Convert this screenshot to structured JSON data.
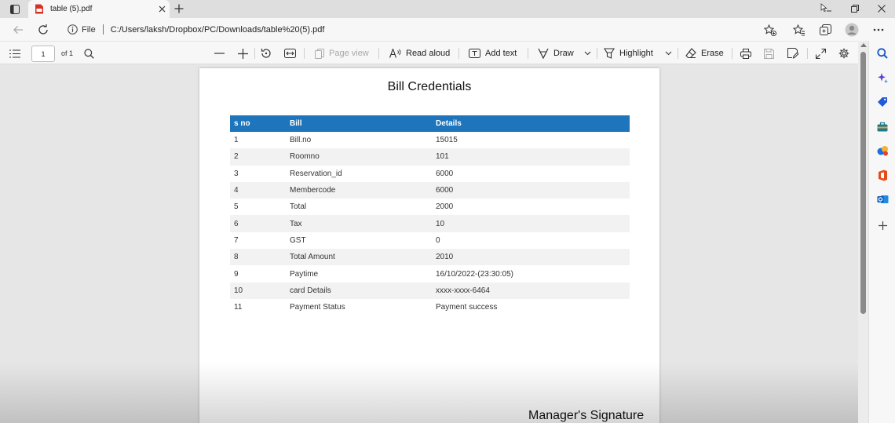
{
  "browser": {
    "tab_title": "table (5).pdf",
    "address": {
      "scheme_label": "File",
      "url": "C:/Users/laksh/Dropbox/PC/Downloads/table%20(5).pdf"
    }
  },
  "pdf_toolbar": {
    "page_number": "1",
    "page_of": "of 1",
    "page_view_label": "Page view",
    "read_aloud_label": "Read aloud",
    "add_text_label": "Add text",
    "draw_label": "Draw",
    "highlight_label": "Highlight",
    "erase_label": "Erase"
  },
  "document": {
    "title": "Bill Credentials",
    "columns": [
      "s no",
      "Bill",
      "Details"
    ],
    "rows": [
      [
        "1",
        "Bill.no",
        "15015"
      ],
      [
        "2",
        "Roomno",
        "101"
      ],
      [
        "3",
        "Reservation_id",
        "6000"
      ],
      [
        "4",
        "Membercode",
        "6000"
      ],
      [
        "5",
        "Total",
        "2000"
      ],
      [
        "6",
        "Tax",
        "10"
      ],
      [
        "7",
        "GST",
        "0"
      ],
      [
        "8",
        "Total Amount",
        "2010"
      ],
      [
        "9",
        "Paytime",
        "16/10/2022-(23:30:05)"
      ],
      [
        "10",
        "card Details",
        "xxxx-xxxx-6464"
      ],
      [
        "11",
        "Payment Status",
        "Payment success"
      ]
    ],
    "signature_label": "Manager's Signature"
  },
  "colors": {
    "table_header_bg": "#1e75bb",
    "row_stripe": "#f2f2f2",
    "pdf_icon": "#d93025"
  },
  "icons": {
    "sidebar": [
      "search-icon",
      "copilot-icon",
      "shopping-tag-icon",
      "toolbox-icon",
      "games-icon",
      "office-icon",
      "outlook-icon",
      "add-icon"
    ]
  }
}
